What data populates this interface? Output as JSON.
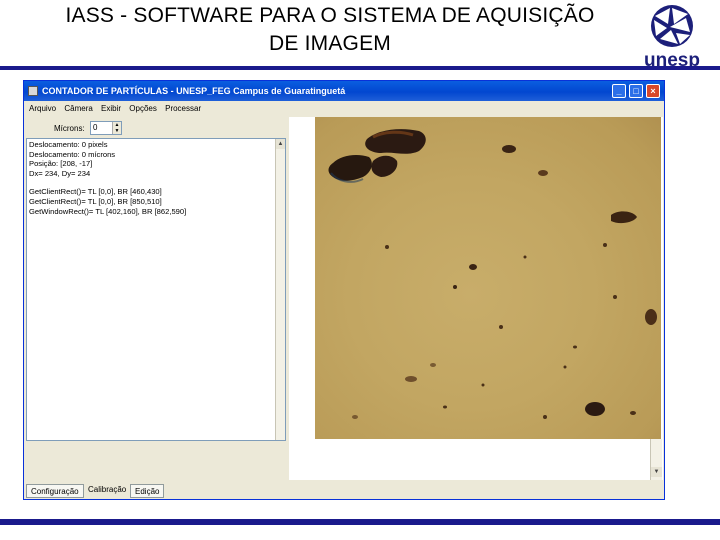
{
  "slide": {
    "title_line1": "IASS - SOFTWARE PARA O SISTEMA DE AQUISIÇÃO",
    "title_line2": "DE IMAGEM",
    "logo_text": "unesp",
    "accent": "#1a1a8c"
  },
  "window": {
    "title": "CONTADOR DE PARTÍCULAS - UNESP_FEG Campus de Guaratinguetá",
    "controls": {
      "minimize": "_",
      "maximize": "□",
      "close": "×"
    }
  },
  "menu": [
    "Arquivo",
    "Câmera",
    "Exibir",
    "Opções",
    "Processar"
  ],
  "microns": {
    "label": "Mícrons:",
    "value": "0"
  },
  "info": {
    "lines": [
      "Deslocamento:   0 pixels",
      "Deslocamento:   0 mícrons",
      "Posição: [208, -17]",
      "Dx= 234, Dy= 234"
    ],
    "rects": [
      "GetClientRect()= TL [0,0], BR [460,430]",
      "GetClientRect()= TL [0,0], BR [850,510]",
      "GetWindowRect()= TL [402,160], BR [862,590]"
    ]
  },
  "tabs": [
    "Configuração",
    "Calibração",
    "Edição"
  ],
  "active_tab": "Calibração"
}
